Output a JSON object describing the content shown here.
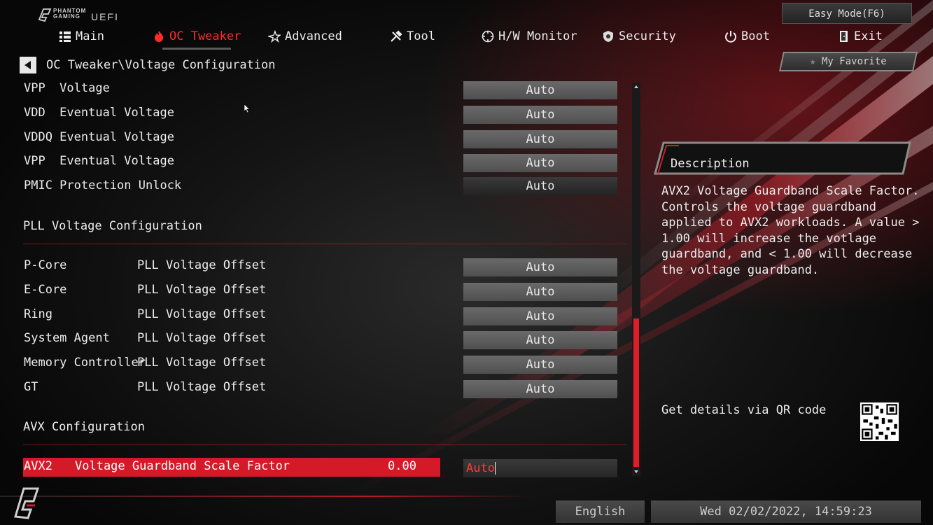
{
  "header": {
    "brand_line1": "PHANTOM",
    "brand_line2": "GAMING",
    "brand_uefi": "UEFI",
    "easy_mode": "Easy Mode(F6)"
  },
  "nav": {
    "tabs": [
      {
        "label": "Main",
        "icon": "list-icon"
      },
      {
        "label": "OC Tweaker",
        "icon": "flame-icon"
      },
      {
        "label": "Advanced",
        "icon": "star-icon"
      },
      {
        "label": "Tool",
        "icon": "tools-icon"
      },
      {
        "label": "H/W Monitor",
        "icon": "monitor-icon"
      },
      {
        "label": "Security",
        "icon": "shield-icon"
      },
      {
        "label": "Boot",
        "icon": "power-icon"
      },
      {
        "label": "Exit",
        "icon": "exit-icon"
      }
    ],
    "active_tab": "OC Tweaker",
    "active_color": "#ff2a2a"
  },
  "breadcrumb": "OC Tweaker\\Voltage Configuration",
  "my_favorite": "My Favorite",
  "voltage_rows": [
    {
      "label": "VPP  Voltage",
      "value": "Auto"
    },
    {
      "label": "VDD  Eventual Voltage",
      "value": "Auto"
    },
    {
      "label": "VDDQ Eventual Voltage",
      "value": "Auto"
    },
    {
      "label": "VPP  Eventual Voltage",
      "value": "Auto"
    },
    {
      "label": "PMIC Protection Unlock",
      "value": "Auto"
    }
  ],
  "pll_section": {
    "title": "PLL Voltage Configuration",
    "rows": [
      {
        "name": "P-Core",
        "setting": "PLL Voltage Offset",
        "value": "Auto"
      },
      {
        "name": "E-Core",
        "setting": "PLL Voltage Offset",
        "value": "Auto"
      },
      {
        "name": "Ring",
        "setting": "PLL Voltage Offset",
        "value": "Auto"
      },
      {
        "name": "System Agent",
        "setting": "PLL Voltage Offset",
        "value": "Auto"
      },
      {
        "name": "Memory Controller",
        "setting": "PLL Voltage Offset",
        "value": "Auto"
      },
      {
        "name": "GT",
        "setting": "PLL Voltage Offset",
        "value": "Auto"
      }
    ]
  },
  "avx_section": {
    "title": "AVX Configuration",
    "selected_row": {
      "prefix": "AVX2",
      "label": "Voltage Guardband Scale Factor",
      "current": "0.00",
      "value": "Auto"
    }
  },
  "description": {
    "title": "Description",
    "body": "AVX2 Voltage Guardband Scale Factor.\nControls the voltage guardband\napplied to AVX2 workloads. A value >\n1.00 will increase the votlage\nguardband, and < 1.00 will decrease\nthe voltage guardband.",
    "qr_text": "Get details via QR code"
  },
  "footer": {
    "language": "English",
    "datetime": "Wed 02/02/2022, 14:59:23"
  },
  "colors": {
    "accent": "#d41a28",
    "selected_value_text": "#ff3b3b"
  }
}
